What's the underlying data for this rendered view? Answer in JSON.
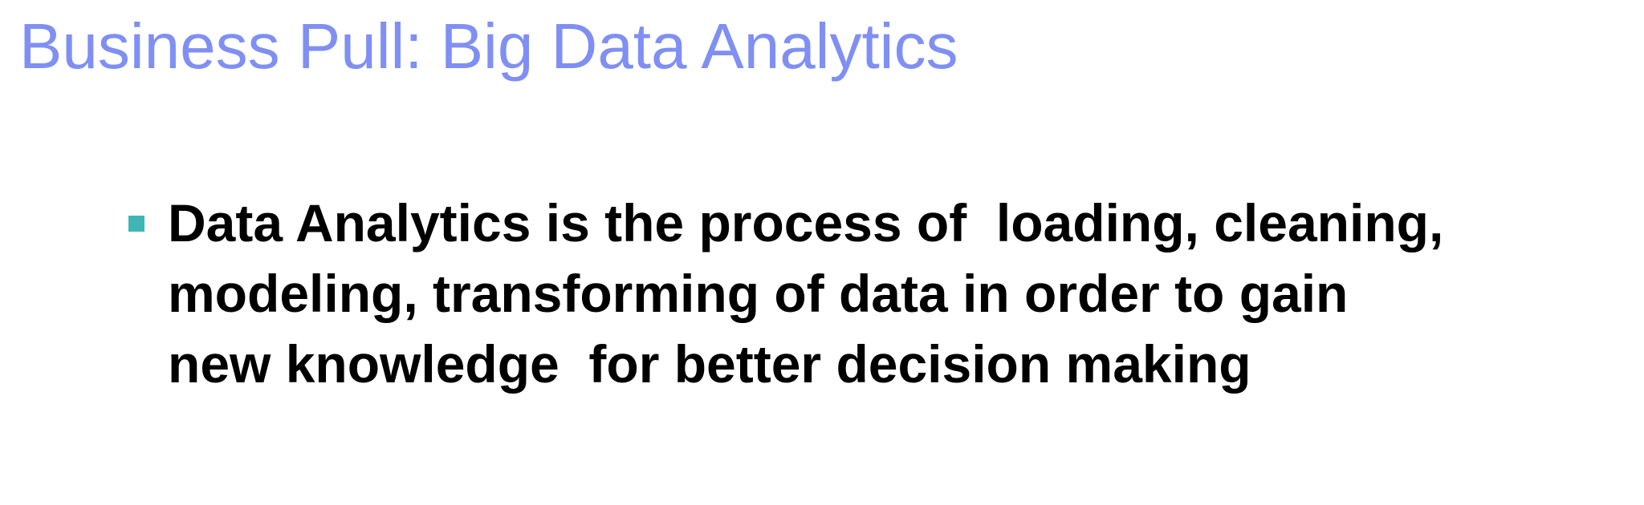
{
  "slide": {
    "title": "Business Pull: Big Data Analytics",
    "bullets": [
      {
        "text": "Data Analytics is the process of  loading, cleaning,\nmodeling, transforming of data in order to gain\nnew knowledge  for better decision making"
      }
    ]
  },
  "colors": {
    "title": "#7f8ff3",
    "bullet_marker": "#3fb6b5",
    "body_text": "#000000",
    "background": "#ffffff"
  }
}
